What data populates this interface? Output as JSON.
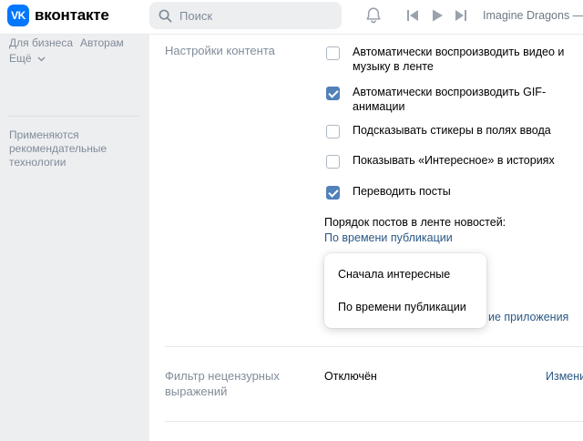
{
  "header": {
    "logo_mark": "VK",
    "logo_text": "вконтакте",
    "search_placeholder": "Поиск",
    "now_playing": "Imagine Dragons — B"
  },
  "sidebar": {
    "links": [
      "Для бизнеса",
      "Авторам",
      "Ещё"
    ],
    "note": "Применяются рекомендательные технологии"
  },
  "content_settings": {
    "label": "Настройки контента",
    "options": [
      {
        "label": "Автоматически воспроизводить видео и музыку в ленте",
        "checked": false
      },
      {
        "label": "Автоматически воспроизводить GIF-анимации",
        "checked": true
      },
      {
        "label": "Подсказывать стикеры в полях ввода",
        "checked": false
      },
      {
        "label": "Показывать «Интересное» в историях",
        "checked": false
      },
      {
        "label": "Переводить посты",
        "checked": true
      }
    ],
    "feed_order_label": "Порядок постов в ленте новостей:",
    "feed_order_value": "По времени публикации",
    "dropdown": [
      "Сначала интересные",
      "По времени публикации"
    ],
    "partially_hidden_link": "ие приложения"
  },
  "filter": {
    "label": "Фильтр нецензурных выражений",
    "value": "Отключён",
    "change": "Измени"
  },
  "colors": {
    "accent": "#0077ff",
    "link": "#2a5885",
    "checkbox_checked": "#5181b8"
  }
}
